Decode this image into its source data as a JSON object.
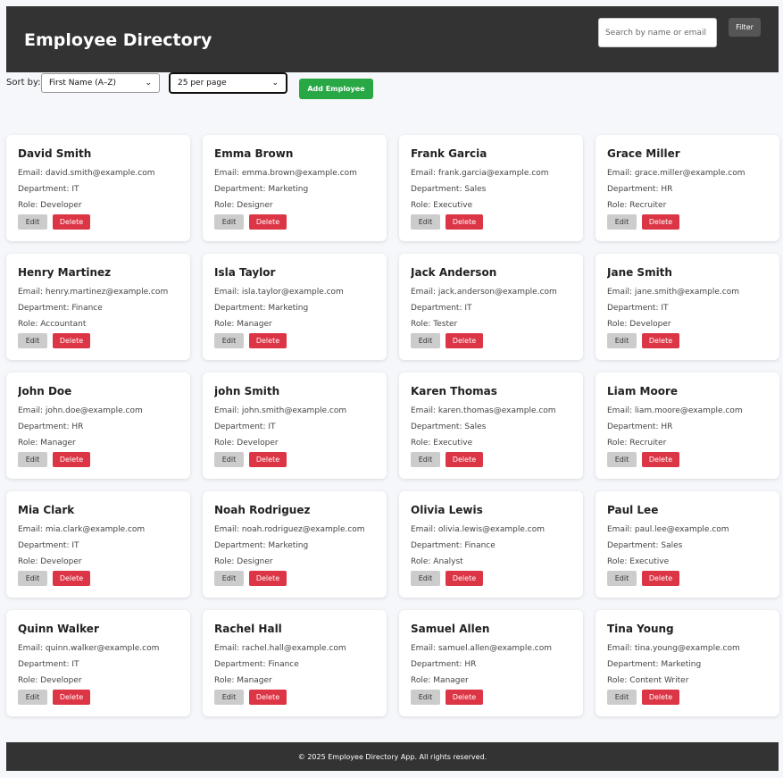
{
  "header": {
    "title": "Employee Directory",
    "search_placeholder": "Search by name or email",
    "search_value": "",
    "filter_label": "Filter"
  },
  "controls": {
    "sort_label": "Sort by:",
    "sort_selected": "First Name (A–Z)",
    "per_page_selected": "25 per page",
    "add_label": "Add Employee"
  },
  "colors": {
    "header_bg": "#333333",
    "add_button": "#28a745",
    "delete_button": "#dc3545",
    "edit_button": "#cccccc"
  },
  "card_labels": {
    "email_prefix": "Email: ",
    "department_prefix": "Department: ",
    "role_prefix": "Role: ",
    "edit": "Edit",
    "delete": "Delete"
  },
  "employees": [
    {
      "name": "David Smith",
      "email": "Email: david.smith@example.com",
      "department": "Department: IT",
      "role": "Role: Developer"
    },
    {
      "name": "Emma Brown",
      "email": "Email: emma.brown@example.com",
      "department": "Department: Marketing",
      "role": "Role: Designer"
    },
    {
      "name": "Frank Garcia",
      "email": "Email: frank.garcia@example.com",
      "department": "Department: Sales",
      "role": "Role: Executive"
    },
    {
      "name": "Grace Miller",
      "email": "Email: grace.miller@example.com",
      "department": "Department: HR",
      "role": "Role: Recruiter"
    },
    {
      "name": "Henry Martinez",
      "email": "Email: henry.martinez@example.com",
      "department": "Department: Finance",
      "role": "Role: Accountant"
    },
    {
      "name": "Isla Taylor",
      "email": "Email: isla.taylor@example.com",
      "department": "Department: Marketing",
      "role": "Role: Manager"
    },
    {
      "name": "Jack Anderson",
      "email": "Email: jack.anderson@example.com",
      "department": "Department: IT",
      "role": "Role: Tester"
    },
    {
      "name": "Jane Smith",
      "email": "Email: jane.smith@example.com",
      "department": "Department: IT",
      "role": "Role: Developer"
    },
    {
      "name": "John Doe",
      "email": "Email: john.doe@example.com",
      "department": "Department: HR",
      "role": "Role: Manager"
    },
    {
      "name": "john Smith",
      "email": "Email: john.smith@example.com",
      "department": "Department: IT",
      "role": "Role: Developer"
    },
    {
      "name": "Karen Thomas",
      "email": "Email: karen.thomas@example.com",
      "department": "Department: Sales",
      "role": "Role: Executive"
    },
    {
      "name": "Liam Moore",
      "email": "Email: liam.moore@example.com",
      "department": "Department: HR",
      "role": "Role: Recruiter"
    },
    {
      "name": "Mia Clark",
      "email": "Email: mia.clark@example.com",
      "department": "Department: IT",
      "role": "Role: Developer"
    },
    {
      "name": "Noah Rodriguez",
      "email": "Email: noah.rodriguez@example.com",
      "department": "Department: Marketing",
      "role": "Role: Designer"
    },
    {
      "name": "Olivia Lewis",
      "email": "Email: olivia.lewis@example.com",
      "department": "Department: Finance",
      "role": "Role: Analyst"
    },
    {
      "name": "Paul Lee",
      "email": "Email: paul.lee@example.com",
      "department": "Department: Sales",
      "role": "Role: Executive"
    },
    {
      "name": "Quinn Walker",
      "email": "Email: quinn.walker@example.com",
      "department": "Department: IT",
      "role": "Role: Developer"
    },
    {
      "name": "Rachel Hall",
      "email": "Email: rachel.hall@example.com",
      "department": "Department: Finance",
      "role": "Role: Manager"
    },
    {
      "name": "Samuel Allen",
      "email": "Email: samuel.allen@example.com",
      "department": "Department: HR",
      "role": "Role: Manager"
    },
    {
      "name": "Tina Young",
      "email": "Email: tina.young@example.com",
      "department": "Department: Marketing",
      "role": "Role: Content Writer"
    }
  ],
  "footer": {
    "text": "© 2025 Employee Directory App. All rights reserved."
  }
}
